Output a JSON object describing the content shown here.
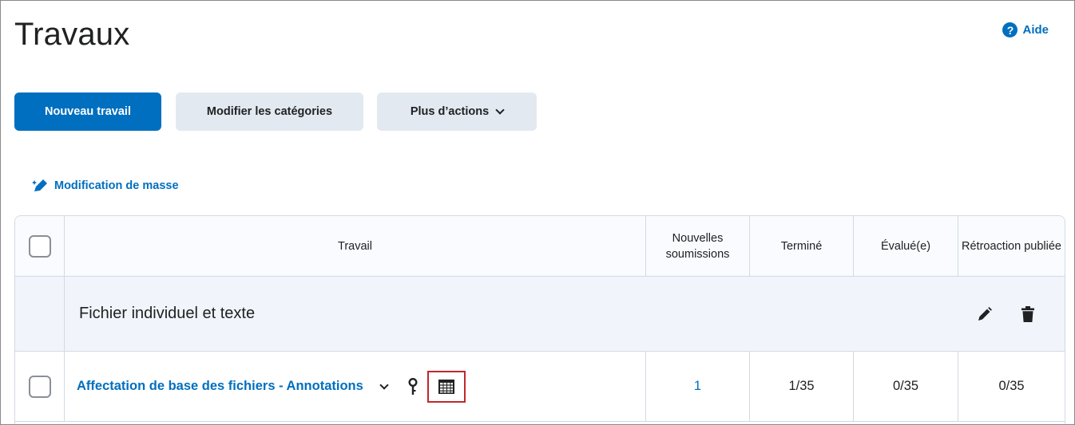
{
  "page": {
    "title": "Travaux"
  },
  "help": {
    "label": "Aide",
    "icon": "help-circle-icon",
    "icon_glyph": "?"
  },
  "toolbar": {
    "new_label": "Nouveau travail",
    "categories_label": "Modifier les catégories",
    "more_label": "Plus d’actions"
  },
  "bulk_edit": {
    "label": "Modification de masse",
    "icon": "pencil-sparkle-icon"
  },
  "table": {
    "headers": {
      "name": "Travail",
      "new_submissions": "Nouvelles soumissions",
      "completed": "Terminé",
      "graded": "Évalué(e)",
      "feedback": "Rétroaction publiée"
    },
    "category": {
      "name": "Fichier individuel et texte",
      "icons": [
        "pencil-icon",
        "trash-icon"
      ]
    },
    "rows": [
      {
        "name": "Affectation de base des fichiers - Annotations",
        "icons": [
          "chevron-down-icon",
          "key-icon",
          "rubric-grid-icon"
        ],
        "new_submissions": "1",
        "completed": "1/35",
        "graded": "0/35",
        "feedback": "0/35"
      }
    ]
  },
  "colors": {
    "accent": "#006fbf",
    "button_secondary": "#e3e9f1",
    "highlight_box": "#c0272d"
  }
}
